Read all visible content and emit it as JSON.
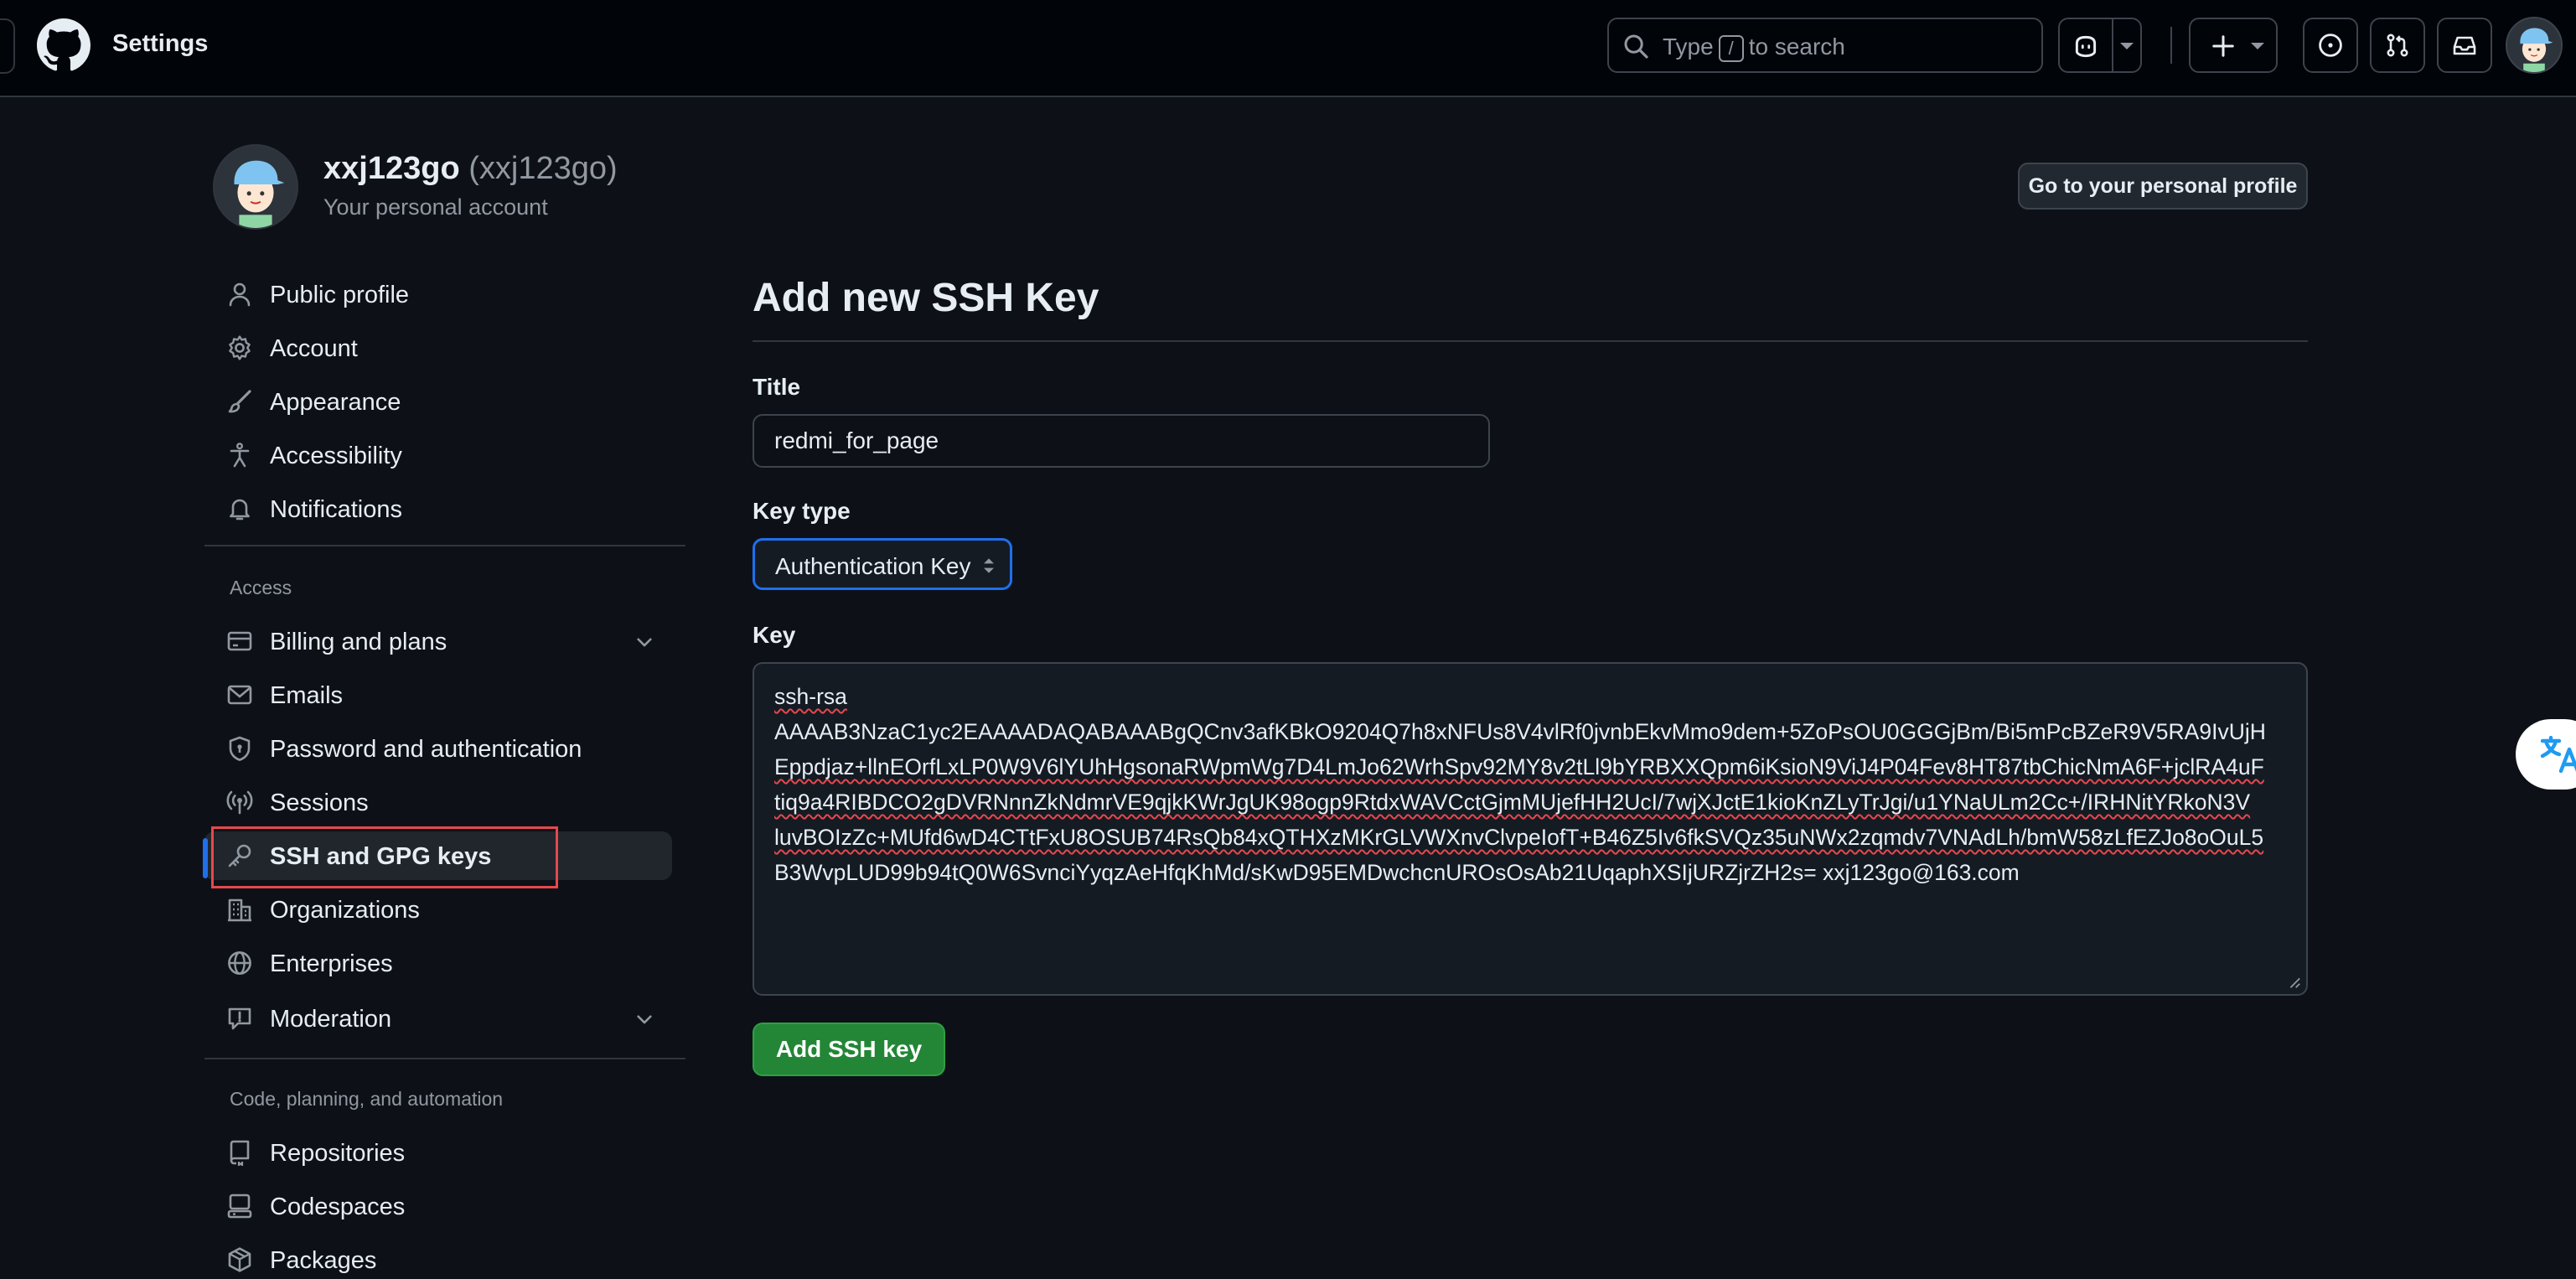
{
  "header": {
    "title": "Settings",
    "search_prefix": "Type",
    "search_key": "/",
    "search_suffix": "to search"
  },
  "account": {
    "username": "xxj123go",
    "login": "(xxj123go)",
    "subtitle": "Your personal account",
    "profile_button": "Go to your personal profile"
  },
  "sidebar": {
    "top_items": [
      {
        "label": "Public profile",
        "icon": "person-icon"
      },
      {
        "label": "Account",
        "icon": "gear-icon"
      },
      {
        "label": "Appearance",
        "icon": "paintbrush-icon"
      },
      {
        "label": "Accessibility",
        "icon": "accessibility-icon"
      },
      {
        "label": "Notifications",
        "icon": "bell-icon"
      }
    ],
    "access_heading": "Access",
    "access_items": [
      {
        "label": "Billing and plans",
        "icon": "credit-card-icon"
      },
      {
        "label": "Emails",
        "icon": "mail-icon"
      },
      {
        "label": "Password and authentication",
        "icon": "shield-lock-icon"
      },
      {
        "label": "Sessions",
        "icon": "broadcast-icon"
      },
      {
        "label": "SSH and GPG keys",
        "icon": "key-icon"
      },
      {
        "label": "Organizations",
        "icon": "organization-icon"
      },
      {
        "label": "Enterprises",
        "icon": "globe-icon"
      },
      {
        "label": "Moderation",
        "icon": "report-icon"
      }
    ],
    "code_heading": "Code, planning, and automation",
    "code_items": [
      {
        "label": "Repositories",
        "icon": "repo-icon"
      },
      {
        "label": "Codespaces",
        "icon": "codespaces-icon"
      },
      {
        "label": "Packages",
        "icon": "package-icon"
      }
    ]
  },
  "form": {
    "heading": "Add new SSH Key",
    "title_label": "Title",
    "title_value": "redmi_for_page",
    "keytype_label": "Key type",
    "keytype_value": "Authentication Key",
    "key_label": "Key",
    "key_lines": [
      "ssh-rsa",
      "AAAAB3NzaC1yc2EAAAADAQABAAABgQCnv3afKBkO9204Q7h8xNFUs8V4vlRf0jvnbEkvMmo9dem+5ZoPsOU0GGGjBm/Bi5mPcBZeR9V5RA9IvUjH",
      "Eppdjaz+llnEOrfLxLP0W9V6lYUhHgsonaRWpmWg7D4LmJo62WrhSpv92MY8v2tLl9bYRBXXQpm6iKsioN9ViJ4P04Fev8HT87tbChicNmA6F+jclRA4uF",
      "tiq9a4RIBDCO2gDVRNnnZkNdmrVE9qjkKWrJgUK98ogp9RtdxWAVCctGjmMUjefHH2UcI/7wjXJctE1kioKnZLyTrJgi/u1YNaULm2Cc+/IRHNitYRkoN3V",
      "luvBOIzZc+MUfd6wD4CTtFxU8OSUB74RsQb84xQTHXzMKrGLVWXnvClvpeIofT+B46Z5Iv6fkSVQz35uNWx2zqmdv7VNAdLh/bmW58zLfEZJo8oOuL5",
      "B3WvpLUD99b94tQ0W6SvnciYyqzAeHfqKhMd/sKwD95EMDwchcnUROsOsAb21UqaphXSIjURZjrZH2s= xxj123go@163.com"
    ],
    "submit_label": "Add SSH key"
  }
}
